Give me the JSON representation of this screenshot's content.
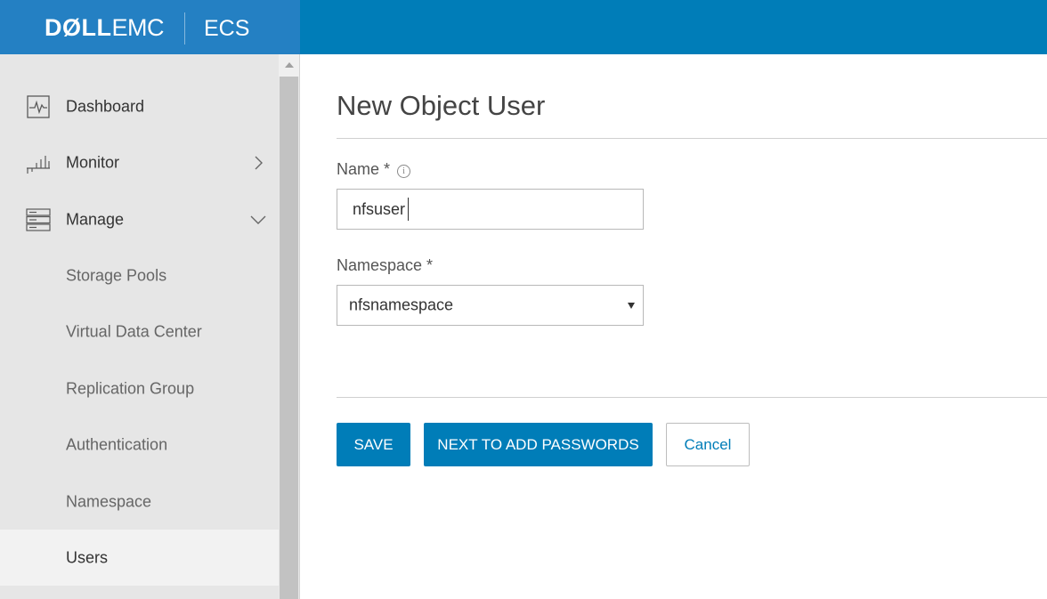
{
  "header": {
    "brand_dell": "DØLL",
    "brand_emc": "EMC",
    "product": "ECS",
    "colors": {
      "header_bg": "#007DB8",
      "brand_bg": "#2480C3"
    }
  },
  "sidebar": {
    "items": [
      {
        "label": "Dashboard",
        "icon": "dashboard-icon"
      },
      {
        "label": "Monitor",
        "icon": "monitor-icon",
        "chevron": "chevron-right-icon"
      },
      {
        "label": "Manage",
        "icon": "manage-icon",
        "chevron": "chevron-down-icon"
      },
      {
        "label": "Storage Pools"
      },
      {
        "label": "Virtual Data Center"
      },
      {
        "label": "Replication Group"
      },
      {
        "label": "Authentication"
      },
      {
        "label": "Namespace"
      },
      {
        "label": "Users",
        "active": true
      }
    ]
  },
  "main": {
    "title": "New Object User",
    "name_field": {
      "label": "Name *",
      "info_glyph": "i",
      "value": "nfsuser"
    },
    "namespace_field": {
      "label": "Namespace *",
      "selected": "nfsnamespace"
    },
    "buttons": {
      "save": "SAVE",
      "next": "NEXT TO ADD PASSWORDS",
      "cancel": "Cancel"
    }
  }
}
